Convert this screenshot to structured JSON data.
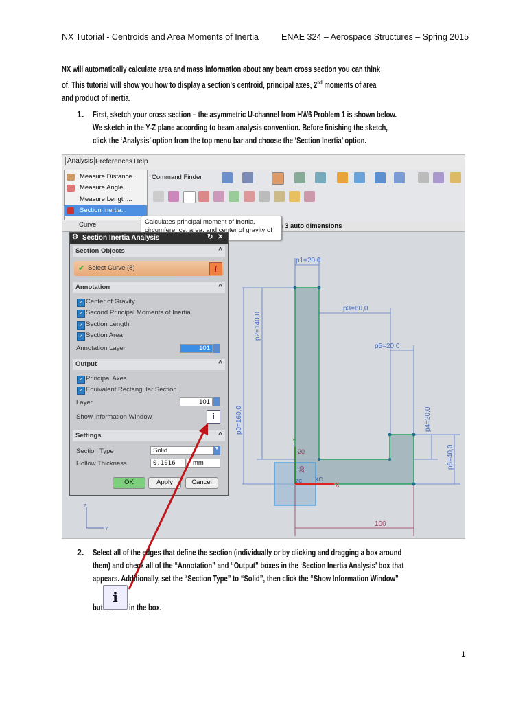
{
  "header": {
    "left": "NX Tutorial - Centroids and Area Moments of Inertia",
    "right": "ENAE 324 – Aerospace Structures – Spring 2015"
  },
  "intro": [
    "NX will automatically calculate area and mass information about any beam cross section you can think",
    "of. This tutorial will show you how to display a section’s centroid, principal axes, 2",
    "moments of area",
    "and product of inertia."
  ],
  "intro_sup": "nd",
  "step1": {
    "num": "1.",
    "lines": [
      "First, sketch your cross section – the asymmetric U-channel from HW6 Problem 1 is shown below.",
      "We sketch in the Y-Z plane according to beam analysis convention. Before finishing the sketch,",
      "click the ‘Analysis’ option from the top menu bar and choose the ‘Section Inertia’ option."
    ]
  },
  "step2": {
    "num": "2.",
    "lines": [
      "Select all of the edges that define the section (individually or by clicking and dragging a box around",
      "them) and check all of the “Annotation” and “Output” boxes in the ‘Section Inertia Analysis’ box that",
      "appears. Additionally, set the “Section Type” to “Solid”, then click the “Show Information Window”"
    ],
    "button_word": "button",
    "after": "in the box."
  },
  "page_number": "1",
  "nx": {
    "menubar": [
      "Analysis",
      "Preferences",
      "Help"
    ],
    "command_finder": "Command Finder",
    "menu_items": [
      "Measure Distance...",
      "Measure Angle...",
      "Measure Length...",
      "Section Inertia...",
      "Curve"
    ],
    "tooltip": [
      "Calculates principal moment of inertia,",
      "circumference, area, and center of gravity of"
    ],
    "status": "constrained with 3 auto dimensions",
    "dialog": {
      "title": "Section Inertia Analysis",
      "section_objects": "Section Objects",
      "select_curve": "Select Curve (8)",
      "annotation": "Annotation",
      "annotation_items": [
        "Center of Gravity",
        "Second Principal Moments of Inertia",
        "Section Length",
        "Section Area"
      ],
      "annotation_layer_label": "Annotation Layer",
      "annotation_layer": "101",
      "output": "Output",
      "output_items": [
        "Principal Axes",
        "Equivalent Rectangular Section"
      ],
      "layer_label": "Layer",
      "layer": "101",
      "show_info": "Show Information Window",
      "settings": "Settings",
      "section_type_label": "Section Type",
      "section_type": "Solid",
      "hollow_label": "Hollow Thickness",
      "hollow": "0.1016",
      "unit": "mm",
      "ok": "OK",
      "apply": "Apply",
      "cancel": "Cancel"
    },
    "dims": {
      "p1": "p1=20,0",
      "p2": "p2=140,0",
      "p0": "p0=160,0",
      "p3": "p3=60,0",
      "p5": "p5=20,0",
      "p4": "p4=20,0",
      "p6": "p6=40,0",
      "w": "100",
      "d20a": "20",
      "d20b": "20",
      "xc": "XC",
      "zc": "ZC",
      "x": "X",
      "y": "Y",
      "z": "Z",
      "ty": "Y"
    }
  }
}
